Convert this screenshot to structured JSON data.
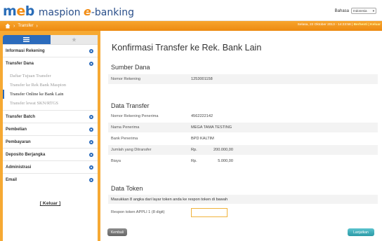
{
  "header": {
    "logo_text_1": "m",
    "logo_text_2": "e",
    "logo_text_3": "b",
    "brand_name": "maspion ",
    "brand_e": "e",
    "brand_suffix": "-banking",
    "language_label": "Bahasa",
    "language_value": "Indonesia"
  },
  "breadcrumb": {
    "item": "Transfer",
    "right_text": "Selasa, 22 Oktober 2013 - 14:23:58 | ",
    "right_exit": "Berhenti | Keluar"
  },
  "sidebar": {
    "items": [
      {
        "label": "Informasi Rekening"
      },
      {
        "label": "Transfer Dana"
      },
      {
        "label": "Transfer Batch"
      },
      {
        "label": "Pembelian"
      },
      {
        "label": "Pembayaran"
      },
      {
        "label": "Deposito Berjangka"
      },
      {
        "label": "Administrasi"
      },
      {
        "label": "Email"
      }
    ],
    "sub_items": [
      {
        "label": "Daftar Tujuan Transfer"
      },
      {
        "label": "Transfer ke Rek Bank Maspion"
      },
      {
        "label": "Transfer Online ke Bank Lain"
      },
      {
        "label": "Transfer lewat SKN/RTGS"
      }
    ],
    "logout": "[ Keluar ]"
  },
  "main": {
    "title": "Konfirmasi Transfer ke Rek. Bank Lain",
    "source_title": "Sumber Dana",
    "source_label": "Nomor Rekening",
    "source_value": "1253001158",
    "transfer_title": "Data Transfer",
    "rows": [
      {
        "label": "Nomor Rekening Penerima",
        "value": "4562222142"
      },
      {
        "label": "Nama Penerima",
        "value": "MEGA TAMA TESTING"
      },
      {
        "label": "Bank Penerima",
        "value": "BPD KALTIM"
      }
    ],
    "amount_label": "Jumlah yang Ditransfer",
    "amount_currency": "Rp.",
    "amount_value": "200.000,00",
    "fee_label": "Biaya",
    "fee_currency": "Rp.",
    "fee_value": "5.000,00",
    "token_title": "Data Token",
    "token_note": "Masukkan 8 angka dari layar token anda ke respon token di bawah",
    "token_label": "Respon token APPLI 1 (8 digit)",
    "back_button": "Kembali",
    "next_button": "Lanjutkan"
  }
}
